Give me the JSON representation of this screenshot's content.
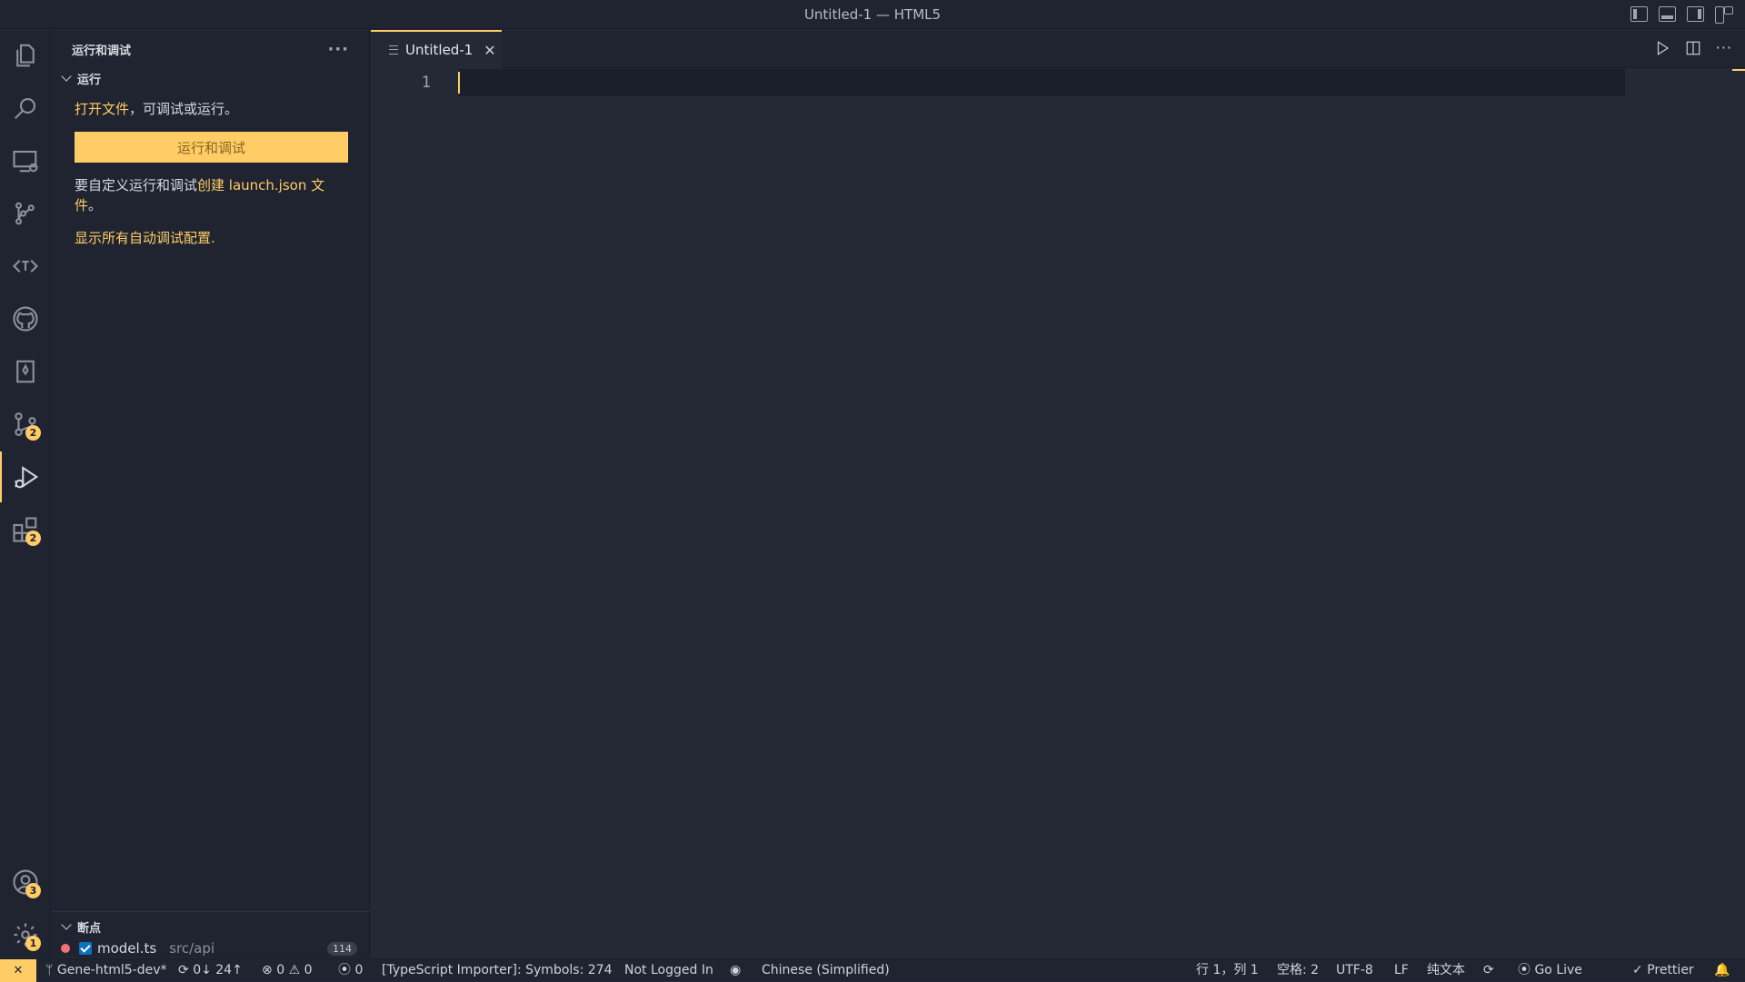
{
  "window": {
    "title": "Untitled-1 — HTML5"
  },
  "activity_bar": {
    "items": [
      {
        "name": "explorer-icon"
      },
      {
        "name": "search-icon"
      },
      {
        "name": "remote-explorer-icon"
      },
      {
        "name": "git-graph-icon"
      },
      {
        "name": "i18n-ally-icon"
      },
      {
        "name": "github-icon"
      },
      {
        "name": "bookmark-icon"
      },
      {
        "name": "source-control-icon",
        "badge": "2"
      },
      {
        "name": "run-debug-icon"
      },
      {
        "name": "extensions-icon",
        "badge": "2"
      }
    ],
    "accounts_badge": "3",
    "settings_badge": "1"
  },
  "sidebar": {
    "title": "运行和调试",
    "more": "···",
    "run_section": {
      "title": "运行",
      "open_file_link": "打开文件",
      "open_file_rest": "，可调试或运行。",
      "button_label": "运行和调试",
      "custom_prefix": "要自定义运行和调试",
      "create_link": "创建 launch.json 文件",
      "custom_suffix": "。",
      "show_all": "显示所有自动调试配置."
    },
    "breakpoints": {
      "title": "断点",
      "file": "model.ts",
      "path": "src/api",
      "count": "114"
    }
  },
  "editor": {
    "tab_label": "Untitled-1",
    "close": "✕",
    "more": "···",
    "line_number": "1"
  },
  "status_bar": {
    "remote": "✕",
    "branch": "Gene-html5-dev*",
    "sync": "0↓ 24↑",
    "errors": "0",
    "warnings": "0",
    "ports": "0",
    "ts_importer": "[TypeScript Importer]: Symbols: 274",
    "login": "Not Logged In",
    "language_pack": "Chinese (Simplified)",
    "cursor_pos": "行 1，列 1",
    "spaces": "空格: 2",
    "encoding": "UTF-8",
    "eol": "LF",
    "mode": "纯文本",
    "go_live": "Go Live",
    "prettier": "Prettier"
  },
  "colors": {
    "accent": "#ffcc66",
    "background": "#1f2430",
    "editor": "#242936"
  }
}
